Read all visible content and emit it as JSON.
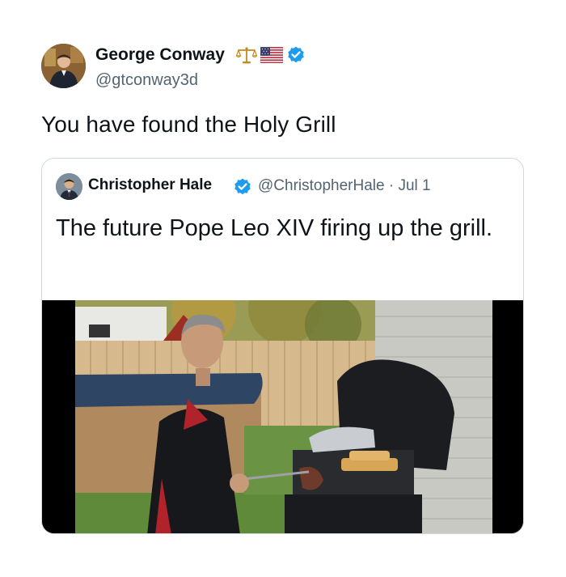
{
  "tweet": {
    "author": {
      "name": "George Conway",
      "handle": "@gtconway3d",
      "avatar_icon": "profile-photo",
      "badges": [
        "scales-emoji",
        "us-flag-emoji",
        "verified-badge"
      ]
    },
    "text": "You have found the Holy Grill",
    "quoted_tweet": {
      "author_name": "Christopher Hale",
      "handle": "@ChristopherHale",
      "separator": "·",
      "date": "Jul 1",
      "text": "The future Pope Leo XIV firing up the grill.",
      "media_icon": "photo-man-grilling-backyard"
    }
  },
  "colors": {
    "text": "#0f1419",
    "secondary_text": "#536471",
    "verified_blue": "#1d9bf0",
    "card_border": "#cfd9de"
  }
}
